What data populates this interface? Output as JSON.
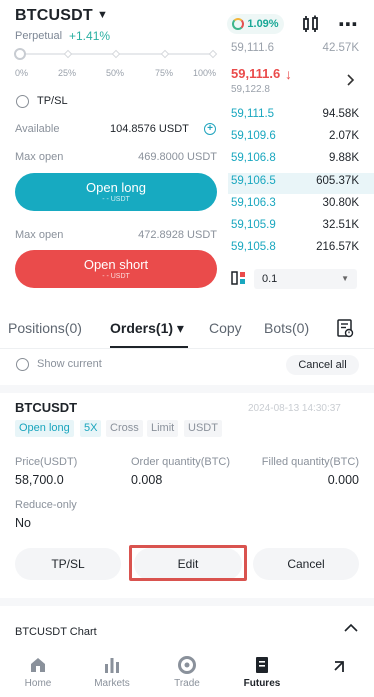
{
  "header": {
    "symbol": "BTCUSDT",
    "caret": "▼",
    "subtitle": "Perpetual",
    "change": "+1.41%",
    "funding_rate": "1.09%",
    "more": "⋯"
  },
  "slider": {
    "labels": [
      "0%",
      "25%",
      "50%",
      "75%",
      "100%"
    ]
  },
  "form": {
    "tpsl_label": "TP/SL",
    "available_label": "Available",
    "available_value": "104.8576 USDT",
    "max_open_label": "Max open",
    "max_open_long": "469.8000 USDT",
    "open_long_label": "Open long",
    "open_long_sub": "- - USDT",
    "max_open_short": "472.8928 USDT",
    "open_short_label": "Open short",
    "open_short_sub": "- - USDT"
  },
  "orderbook": {
    "top_partial": {
      "price": "59,111.6",
      "vol": "42.57K"
    },
    "mid_price": "59,111.6",
    "mid_arrow": "↓",
    "mark_price": "59,122.8",
    "bids": [
      {
        "price": "59,111.5",
        "vol": "94.58K"
      },
      {
        "price": "59,109.6",
        "vol": "2.07K"
      },
      {
        "price": "59,106.8",
        "vol": "9.88K"
      },
      {
        "price": "59,106.5",
        "vol": "605.37K"
      },
      {
        "price": "59,106.3",
        "vol": "30.80K"
      },
      {
        "price": "59,105.9",
        "vol": "32.51K"
      },
      {
        "price": "59,105.8",
        "vol": "216.57K"
      }
    ],
    "depth_value": "0.1"
  },
  "tabs": {
    "positions": "Positions(0)",
    "orders": "Orders(1) ▾",
    "copy": "Copy",
    "bots": "Bots(0)"
  },
  "filters": {
    "show_current": "Show current",
    "cancel_all": "Cancel all"
  },
  "order": {
    "symbol": "BTCUSDT",
    "time": "2024-08-13 14:30:37",
    "tags": [
      "Open long",
      "5X",
      "Cross",
      "Limit",
      "USDT"
    ],
    "price_label": "Price(USDT)",
    "price_value": "58,700.0",
    "qty_label": "Order quantity(BTC)",
    "qty_value": "0.008",
    "filled_label": "Filled quantity(BTC)",
    "filled_value": "0.000",
    "reduce_label": "Reduce-only",
    "reduce_value": "No",
    "btn_tpsl": "TP/SL",
    "btn_edit": "Edit",
    "btn_cancel": "Cancel"
  },
  "chart_bar": {
    "label": "BTCUSDT  Chart"
  },
  "nav": {
    "home": "Home",
    "markets": "Markets",
    "trade": "Trade",
    "futures": "Futures"
  },
  "colors": {
    "accent": "#17aac1",
    "sell": "#ea4b4b",
    "buy": "#19a7bf"
  }
}
